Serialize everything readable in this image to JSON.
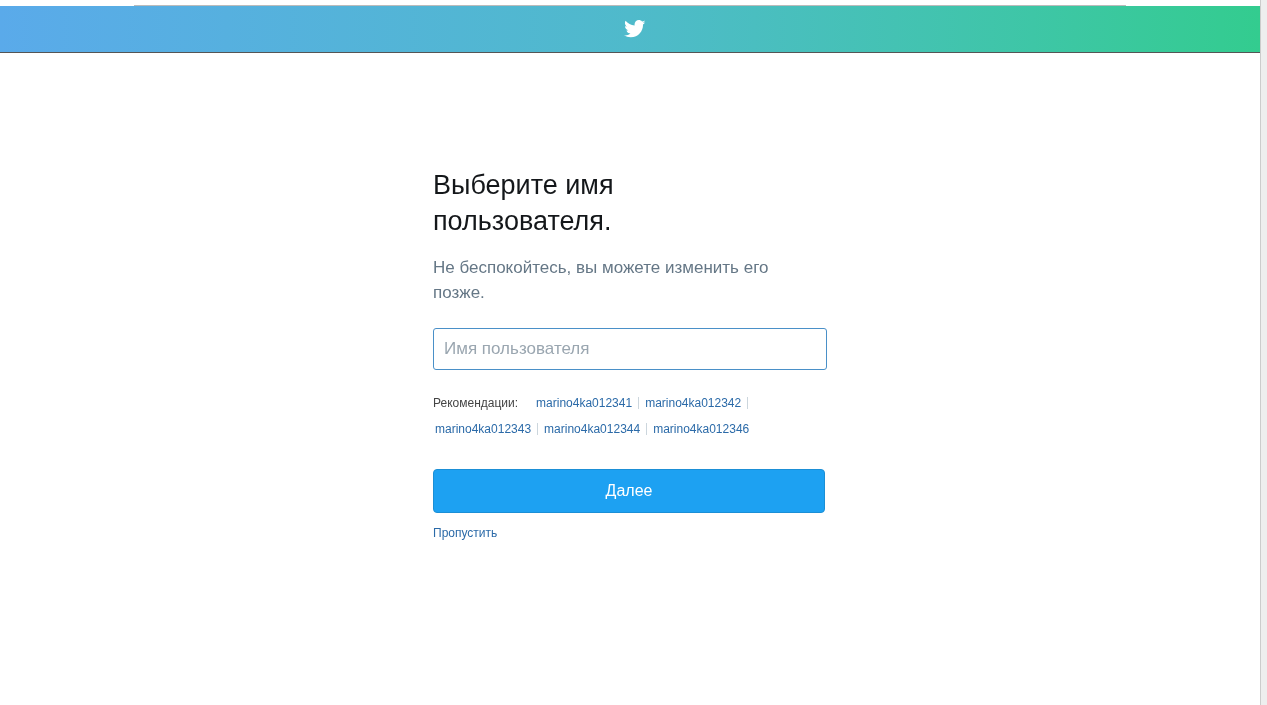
{
  "title": "Выберите имя пользователя.",
  "subtitle": "Не беспокойтесь, вы можете изменить его позже.",
  "username_field": {
    "placeholder": "Имя пользователя"
  },
  "suggestions": {
    "label": "Рекомендации:",
    "items": [
      "marino4ka012341",
      "marino4ka012342",
      "marino4ka012343",
      "marino4ka012344",
      "marino4ka012346"
    ]
  },
  "next_button": "Далее",
  "skip_link": "Пропустить"
}
